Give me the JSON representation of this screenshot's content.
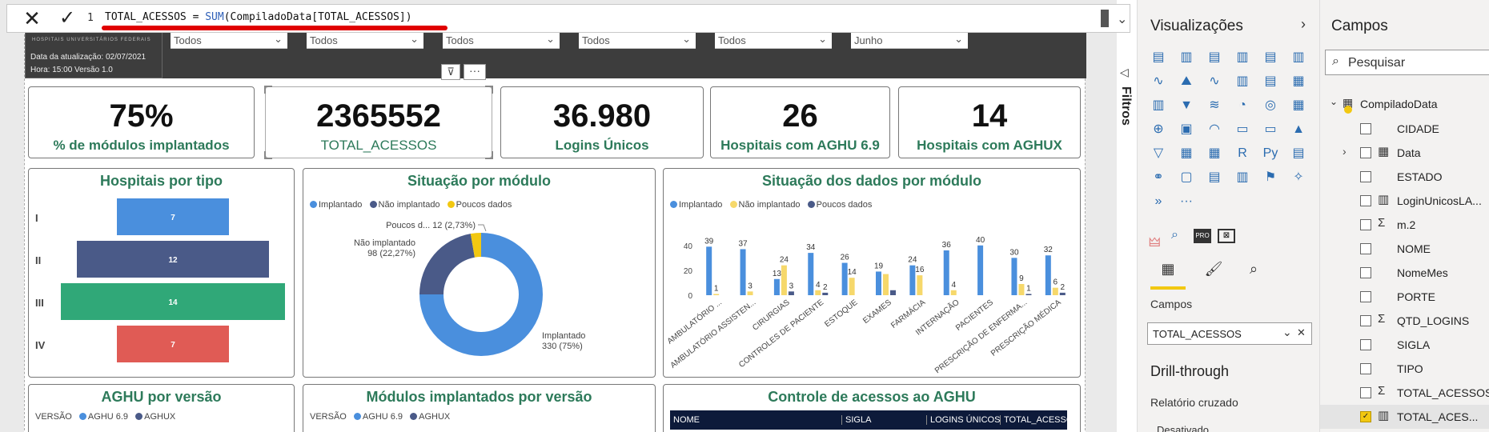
{
  "formula": {
    "line_number": "1",
    "measure": "TOTAL_ACESSOS",
    "equals": "=",
    "function": "SUM",
    "argument": "(CompiladoData[TOTAL_ACESSOS])",
    "cancel_icon": "close-icon",
    "commit_icon": "checkmark-icon"
  },
  "header": {
    "org": "HOSPITAIS UNIVERSITÁRIOS FEDERAIS",
    "update_date": "Data da atualização: 02/07/2021",
    "time_version": "Hora: 15:00 Versão 1.0",
    "slicers": [
      "Todos",
      "Todos",
      "Todos",
      "Todos",
      "Todos",
      "Junho"
    ]
  },
  "cards": [
    {
      "value": "75%",
      "label": "% de módulos implantados"
    },
    {
      "value": "2365552",
      "label": "TOTAL_ACESSOS"
    },
    {
      "value": "36.980",
      "label": "Logins Únicos"
    },
    {
      "value": "26",
      "label": "Hospitais com AGHU 6.9"
    },
    {
      "value": "14",
      "label": "Hospitais com AGHUX"
    }
  ],
  "panels": {
    "hosp_tipo": {
      "title": "Hospitais por tipo"
    },
    "sit_modulo": {
      "title": "Situação por módulo"
    },
    "sit_dados": {
      "title": "Situação dos dados por módulo"
    },
    "aghu_versao": {
      "title": "AGHU por versão",
      "legend_prefix": "VERSÃO",
      "legend": [
        "AGHU 6.9",
        "AGHUX"
      ]
    },
    "mod_versao": {
      "title": "Módulos implantados por versão",
      "legend_prefix": "VERSÃO",
      "legend": [
        "AGHU 6.9",
        "AGHUX"
      ]
    },
    "controle": {
      "title": "Controle de acessos ao AGHU",
      "columns": [
        "NOME",
        "SIGLA",
        "LOGINS ÚNICOS",
        "TOTAL_ACESSOS"
      ]
    }
  },
  "chart_data": [
    {
      "type": "bar",
      "orientation": "horizontal-funnel",
      "title": "Hospitais por tipo",
      "categories": [
        "I",
        "II",
        "III",
        "IV"
      ],
      "values": [
        7,
        12,
        14,
        7
      ],
      "colors": [
        "#4a8fdd",
        "#4a5a88",
        "#30a878",
        "#e05b55"
      ]
    },
    {
      "type": "pie",
      "title": "Situação por módulo",
      "legend": [
        "Implantado",
        "Não implantado",
        "Poucos dados"
      ],
      "slices": [
        {
          "name": "Implantado",
          "value": 330,
          "label": "Implantado",
          "label2": "330 (75%)",
          "color": "#4a8fdd"
        },
        {
          "name": "Não implantado",
          "value": 98,
          "label": "Não implantado",
          "label2": "98 (22,27%)",
          "color": "#4a5a88"
        },
        {
          "name": "Poucos dados",
          "value": 12,
          "label": "Poucos d... 12 (2,73%)",
          "color": "#f2c811"
        }
      ]
    },
    {
      "type": "bar",
      "title": "Situação dos dados por módulo",
      "legend": [
        "Implantado",
        "Não implantado",
        "Poucos dados"
      ],
      "categories": [
        "AMBULATÓRIO ...",
        "AMBULATÓRIO ASSISTEN...",
        "CIRURGIAS",
        "CONTROLES DE PACIENTE",
        "ESTOQUE",
        "EXAMES",
        "FARMÁCIA",
        "INTERNAÇÃO",
        "PACIENTES",
        "PRESCRIÇÃO DE ENFERMA...",
        "PRESCRIÇÃO MÉDICA"
      ],
      "yticks": [
        "0",
        "20",
        "40"
      ],
      "ylim": [
        0,
        45
      ],
      "series": [
        {
          "name": "Implantado",
          "color": "#4a8fdd",
          "values": [
            39,
            37,
            13,
            34,
            26,
            19,
            24,
            36,
            40,
            30,
            32
          ],
          "labels": [
            "39",
            "37",
            "13",
            "34",
            "26",
            "19",
            "24",
            "36",
            "40",
            "30",
            "32"
          ]
        },
        {
          "name": "Não implantado",
          "color": "#f6d86b",
          "values": [
            1,
            3,
            24,
            4,
            14,
            17,
            16,
            4,
            0,
            9,
            6
          ],
          "labels": [
            "1",
            "3",
            "24",
            "4",
            "14",
            "",
            "16",
            "4",
            "",
            "9",
            "6"
          ]
        },
        {
          "name": "Poucos dados",
          "color": "#4a5a88",
          "values": [
            0,
            0,
            3,
            2,
            0,
            4,
            0,
            0,
            0,
            1,
            2
          ],
          "labels": [
            "",
            "",
            "3",
            "2",
            "",
            "",
            "",
            "",
            "",
            "1",
            "2"
          ]
        }
      ]
    }
  ],
  "viz_pane": {
    "title": "Visualizações",
    "expand_icon": "chevron-right-icon",
    "tab_fields_label": "Campos",
    "well_value": "TOTAL_ACESSOS",
    "drill_title": "Drill-through",
    "drill_cross": "Relatório cruzado",
    "drill_state": "Desativado"
  },
  "filters_label": "Filtros",
  "fields_pane": {
    "title": "Campos",
    "search_placeholder": "Pesquisar",
    "table": "CompiladoData",
    "fields": [
      {
        "name": "CIDADE",
        "icon": "",
        "checked": false
      },
      {
        "name": "Data",
        "icon": "calendar-icon",
        "checked": false
      },
      {
        "name": "ESTADO",
        "icon": "",
        "checked": false
      },
      {
        "name": "LoginUnicosLA...",
        "icon": "calculator-icon",
        "checked": false
      },
      {
        "name": "m.2",
        "icon": "sigma-icon",
        "checked": false
      },
      {
        "name": "NOME",
        "icon": "",
        "checked": false
      },
      {
        "name": "NomeMes",
        "icon": "",
        "checked": false
      },
      {
        "name": "PORTE",
        "icon": "",
        "checked": false
      },
      {
        "name": "QTD_LOGINS",
        "icon": "sigma-icon",
        "checked": false
      },
      {
        "name": "SIGLA",
        "icon": "",
        "checked": false
      },
      {
        "name": "TIPO",
        "icon": "",
        "checked": false
      },
      {
        "name": "TOTAL_ACESSOS",
        "icon": "sigma-icon",
        "checked": false
      },
      {
        "name": "TOTAL_ACES...",
        "icon": "calculator-icon",
        "checked": true
      }
    ]
  }
}
